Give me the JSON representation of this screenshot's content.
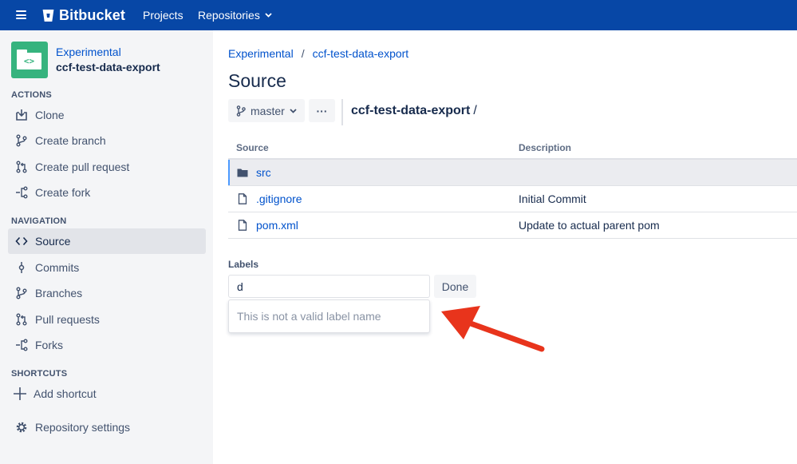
{
  "topbar": {
    "brand": "Bitbucket",
    "nav": {
      "projects": "Projects",
      "repositories": "Repositories"
    }
  },
  "sidebar": {
    "repo": {
      "project": "Experimental",
      "name": "ccf-test-data-export"
    },
    "sections": {
      "actions": "ACTIONS",
      "navigation": "NAVIGATION",
      "shortcuts": "SHORTCUTS"
    },
    "actions": [
      {
        "label": "Clone",
        "icon": "clone-icon"
      },
      {
        "label": "Create branch",
        "icon": "branch-icon"
      },
      {
        "label": "Create pull request",
        "icon": "pull-request-icon"
      },
      {
        "label": "Create fork",
        "icon": "fork-icon"
      }
    ],
    "navigation": [
      {
        "label": "Source",
        "icon": "code-icon",
        "active": true
      },
      {
        "label": "Commits",
        "icon": "commit-icon"
      },
      {
        "label": "Branches",
        "icon": "branch-icon"
      },
      {
        "label": "Pull requests",
        "icon": "pull-request-icon"
      },
      {
        "label": "Forks",
        "icon": "fork-icon"
      }
    ],
    "shortcuts": {
      "add": "Add shortcut"
    },
    "settings": "Repository settings"
  },
  "main": {
    "breadcrumb": {
      "project": "Experimental",
      "sep": "/",
      "repo": "ccf-test-data-export"
    },
    "title": "Source",
    "branch": "master",
    "more": "···",
    "path": {
      "repo": "ccf-test-data-export",
      "slash": "/"
    },
    "table": {
      "headers": {
        "source": "Source",
        "description": "Description"
      },
      "rows": [
        {
          "name": "src",
          "type": "folder",
          "description": ""
        },
        {
          "name": ".gitignore",
          "type": "file",
          "description": "Initial Commit"
        },
        {
          "name": "pom.xml",
          "type": "file",
          "description": "Update to actual parent pom"
        }
      ]
    },
    "labels": {
      "title": "Labels",
      "input_value": "d",
      "done": "Done",
      "error": "This is not a valid label name"
    }
  },
  "colors": {
    "topbar": "#0747A6",
    "link": "#0052CC",
    "repo_avatar": "#36B37E",
    "annotation_arrow": "#E8341C"
  }
}
